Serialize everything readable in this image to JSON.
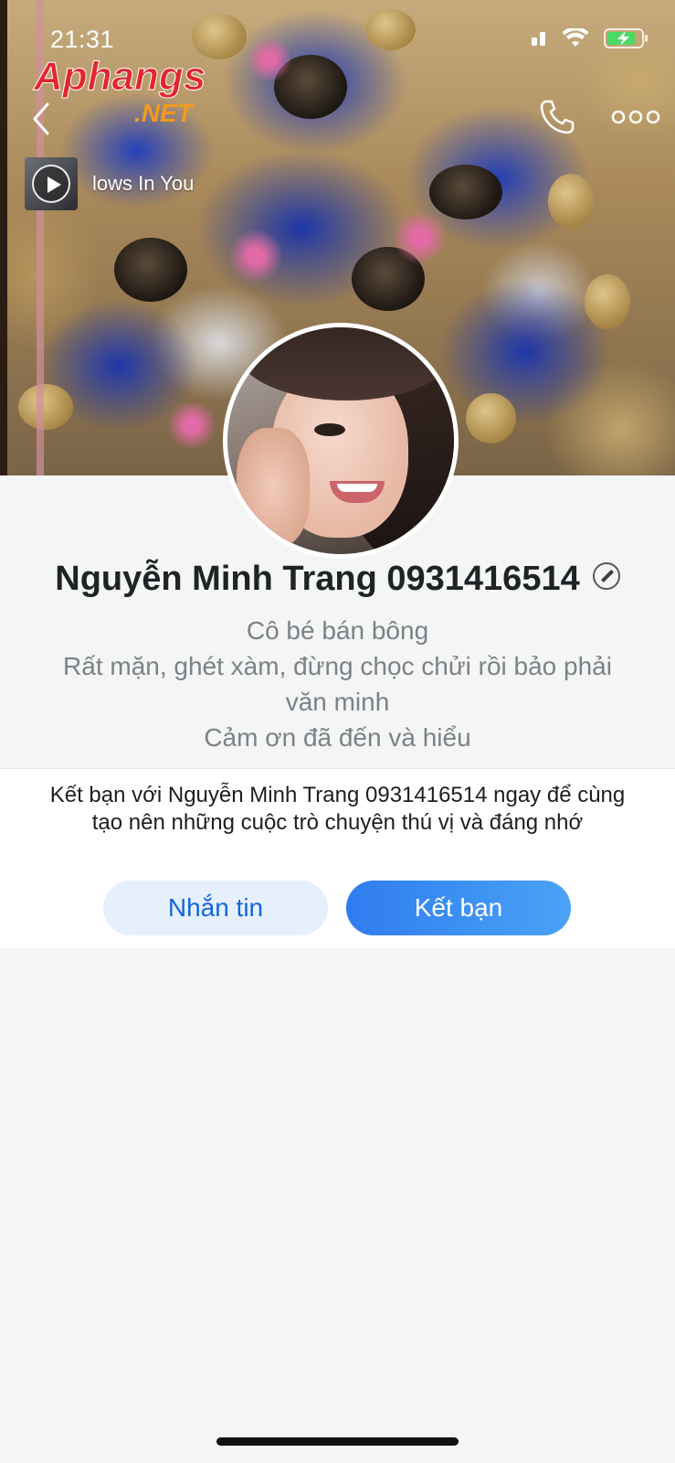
{
  "status_bar": {
    "time": "21:31"
  },
  "watermark": {
    "brand": "Aphangs",
    "suffix": ".NET"
  },
  "header": {
    "back_icon": "chevron-left-icon",
    "call_icon": "phone-icon",
    "more_icon": "more-dots-icon"
  },
  "music": {
    "title": "lows In You",
    "play_icon": "play-icon"
  },
  "profile": {
    "name": "Nguyễn Minh Trang 0931416514",
    "bio": [
      "Cô bé bán bông",
      "Rất mặn, ghét xàm, đừng chọc chửi rồi bảo phải",
      "văn minh",
      "Cảm ơn đã đến và hiểu"
    ]
  },
  "friend_prompt": {
    "text": "Kết bạn với Nguyễn Minh Trang 0931416514 ngay để cùng tạo nên những cuộc trò chuyện thú vị và đáng nhớ",
    "message_button": "Nhắn tin",
    "add_friend_button": "Kết bạn"
  },
  "colors": {
    "primary": "#2f7cf0",
    "secondary_button_bg": "#e6f0fd",
    "page_bg": "#f4f5f5"
  }
}
